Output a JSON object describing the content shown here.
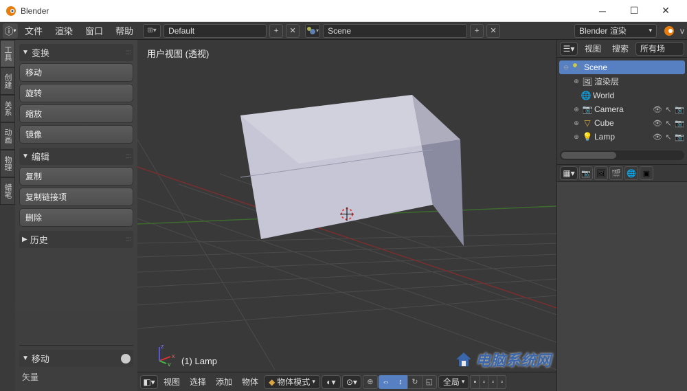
{
  "titlebar": {
    "title": "Blender"
  },
  "menubar": {
    "items": [
      "文件",
      "渲染",
      "窗口",
      "帮助"
    ],
    "layout": "Default",
    "scene": "Scene",
    "engine": "Blender 渲染",
    "version_prefix": "v"
  },
  "toolshelf": {
    "tabs": [
      "工具",
      "创建",
      "关系",
      "动画",
      "物理",
      "蜡笔"
    ],
    "sections": {
      "transform": {
        "title": "变换",
        "buttons": [
          "移动",
          "旋转",
          "缩放",
          "镜像"
        ]
      },
      "edit": {
        "title": "编辑",
        "buttons": [
          "复制",
          "复制链接项",
          "删除"
        ]
      },
      "history": {
        "title": "历史"
      }
    },
    "operator": {
      "title": "移动",
      "field": "矢量"
    }
  },
  "viewport": {
    "label": "用户视图  (透视)",
    "object_label": "(1) Lamp",
    "toolbar": {
      "menus": [
        "视图",
        "选择",
        "添加",
        "物体"
      ],
      "mode": "物体模式",
      "pivot_label": "全局"
    }
  },
  "outliner": {
    "header": {
      "view": "视图",
      "search": "搜索",
      "filter": "所有场"
    },
    "scene": "Scene",
    "render_layers": "渲染层",
    "world": "World",
    "items": [
      {
        "name": "Camera",
        "icon": "camera"
      },
      {
        "name": "Cube",
        "icon": "mesh"
      },
      {
        "name": "Lamp",
        "icon": "lamp"
      }
    ]
  },
  "watermark": "电脑系统网"
}
